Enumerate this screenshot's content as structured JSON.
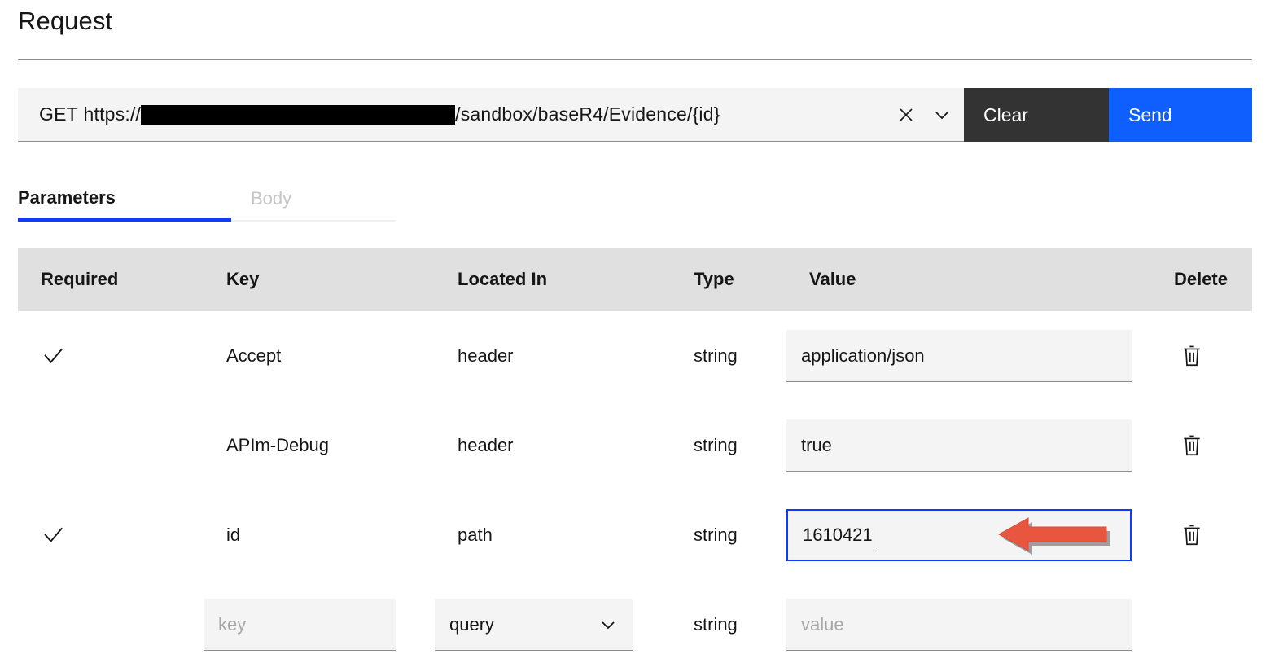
{
  "page": {
    "title": "Request"
  },
  "url_bar": {
    "method": "GET",
    "scheme": "https://",
    "host_redacted": true,
    "path": "/sandbox/baseR4/Evidence/{id}",
    "clear_icon": "close-icon",
    "expand_icon": "chevron-down-icon",
    "clear_label": "Clear",
    "send_label": "Send",
    "clear_button_color": "#333333",
    "send_button_color": "#0f5ffe"
  },
  "tabs": [
    {
      "label": "Parameters",
      "active": true
    },
    {
      "label": "Body",
      "active": false
    }
  ],
  "table": {
    "headers": [
      "Required",
      "Key",
      "Located In",
      "Type",
      "Value",
      "Delete"
    ],
    "rows": [
      {
        "required": true,
        "key": "Accept",
        "located_in": "header",
        "type": "string",
        "value": "application/json",
        "value_placeholder": "",
        "focused": false,
        "delete_icon": "trash-icon"
      },
      {
        "required": false,
        "key": "APIm-Debug",
        "located_in": "header",
        "type": "string",
        "value": "true",
        "value_placeholder": "",
        "focused": false,
        "delete_icon": "trash-icon"
      },
      {
        "required": true,
        "key": "id",
        "located_in": "path",
        "type": "string",
        "value": "1610421",
        "value_placeholder": "",
        "focused": true,
        "delete_icon": "trash-icon"
      }
    ],
    "new_row": {
      "key_placeholder": "key",
      "located_in_selected": "query",
      "located_in_icon": "chevron-down-icon",
      "type": "string",
      "value_placeholder": "value"
    }
  },
  "annotation": {
    "arrow_color": "#e8563f",
    "arrow_direction": "left",
    "points_at": "id-value-input"
  },
  "theme": {
    "accent_blue": "#0f3bfe",
    "send_blue": "#0f5ffe",
    "field_bg": "#f4f4f4",
    "header_bg": "#e0e0e0",
    "border_gray": "#8d8d8d",
    "muted_text": "#a8a8a8"
  }
}
